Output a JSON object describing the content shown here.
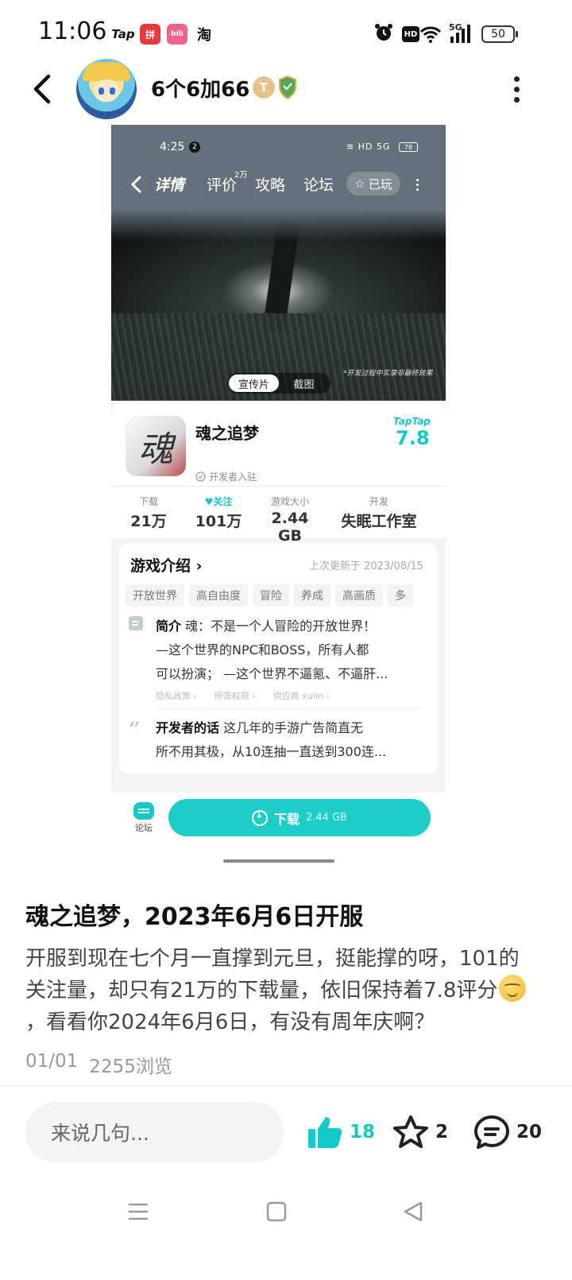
{
  "status_bar": {
    "time": "11:06",
    "apps": [
      "Tap",
      "拼",
      "bili",
      "淘"
    ],
    "hd": "HD",
    "network": "5G",
    "battery": "50"
  },
  "header": {
    "username": "6个6加66",
    "level_badge": "T",
    "icons": [
      "back-arrow-icon",
      "avatar",
      "level-badge-icon",
      "shield-badge-icon",
      "more-vertical-icon"
    ]
  },
  "screenshot": {
    "status_time": "4:25",
    "notification_count": "2",
    "status_icons": "≋ HD 5G",
    "battery": "78",
    "tabs": [
      {
        "label": "详情",
        "active": true
      },
      {
        "label": "评价",
        "sup": "2万"
      },
      {
        "label": "攻略"
      },
      {
        "label": "论坛"
      }
    ],
    "played_label": "已玩",
    "video_caption": "*开发过程中实录非最终效果",
    "media_toggle": [
      "宣传片",
      "截图"
    ],
    "game": {
      "name": "魂之追梦",
      "icon_char": "魂",
      "developer_tag": "开发者入驻",
      "taptap_logo": "TapTap",
      "score": "7.8"
    },
    "stats": [
      {
        "label": "下载",
        "value": "21万"
      },
      {
        "label": "关注",
        "value": "101万"
      },
      {
        "label": "游戏大小",
        "value": "2.44 GB"
      },
      {
        "label": "开发",
        "value": "失眠工作室"
      }
    ],
    "intro": {
      "title": "游戏介绍",
      "updated": "上次更新于 2023/08/15",
      "tags": [
        "开放世界",
        "高自由度",
        "冒险",
        "养成",
        "高画质",
        "多"
      ],
      "brief_label": "简介",
      "brief_lines": [
        "魂：不是一个人冒险的开放世界！",
        "—这个世界的NPC和BOSS，所有人都",
        "可以扮演； —这个世界不逼氪、不逼肝..."
      ],
      "links": [
        "隐私政策",
        "所需权限",
        "供应商 xulin"
      ],
      "dev_words_label": "开发者的话",
      "dev_words_lines": [
        "这几年的手游广告简直无",
        "所不用其极，从10连抽一直送到300连..."
      ]
    },
    "bottom": {
      "forum_label": "论坛",
      "download_label": "下载",
      "download_size": "2.44 GB"
    }
  },
  "post": {
    "title": "魂之追梦，2023年6月6日开服",
    "body_part1": "开服到现在七个月一直撑到元旦，挺能撑的呀，101的关注量，却只有21万的下载量，依旧保持着7.8评分",
    "body_part2": "，看看你2024年6月6日，有没有周年庆啊？",
    "date": "01/01",
    "views": "2255浏览"
  },
  "actions": {
    "comment_placeholder": "来说几句...",
    "likes": "18",
    "favorites": "2",
    "comments": "20",
    "accent_color": "#14c9c9"
  }
}
